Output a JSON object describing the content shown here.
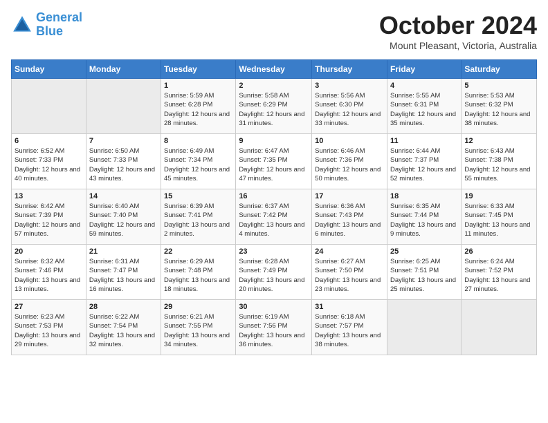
{
  "logo": {
    "line1": "General",
    "line2": "Blue"
  },
  "title": "October 2024",
  "subtitle": "Mount Pleasant, Victoria, Australia",
  "days_of_week": [
    "Sunday",
    "Monday",
    "Tuesday",
    "Wednesday",
    "Thursday",
    "Friday",
    "Saturday"
  ],
  "weeks": [
    [
      {
        "day": "",
        "info": ""
      },
      {
        "day": "",
        "info": ""
      },
      {
        "day": "1",
        "info": "Sunrise: 5:59 AM\nSunset: 6:28 PM\nDaylight: 12 hours and 28 minutes."
      },
      {
        "day": "2",
        "info": "Sunrise: 5:58 AM\nSunset: 6:29 PM\nDaylight: 12 hours and 31 minutes."
      },
      {
        "day": "3",
        "info": "Sunrise: 5:56 AM\nSunset: 6:30 PM\nDaylight: 12 hours and 33 minutes."
      },
      {
        "day": "4",
        "info": "Sunrise: 5:55 AM\nSunset: 6:31 PM\nDaylight: 12 hours and 35 minutes."
      },
      {
        "day": "5",
        "info": "Sunrise: 5:53 AM\nSunset: 6:32 PM\nDaylight: 12 hours and 38 minutes."
      }
    ],
    [
      {
        "day": "6",
        "info": "Sunrise: 6:52 AM\nSunset: 7:33 PM\nDaylight: 12 hours and 40 minutes."
      },
      {
        "day": "7",
        "info": "Sunrise: 6:50 AM\nSunset: 7:33 PM\nDaylight: 12 hours and 43 minutes."
      },
      {
        "day": "8",
        "info": "Sunrise: 6:49 AM\nSunset: 7:34 PM\nDaylight: 12 hours and 45 minutes."
      },
      {
        "day": "9",
        "info": "Sunrise: 6:47 AM\nSunset: 7:35 PM\nDaylight: 12 hours and 47 minutes."
      },
      {
        "day": "10",
        "info": "Sunrise: 6:46 AM\nSunset: 7:36 PM\nDaylight: 12 hours and 50 minutes."
      },
      {
        "day": "11",
        "info": "Sunrise: 6:44 AM\nSunset: 7:37 PM\nDaylight: 12 hours and 52 minutes."
      },
      {
        "day": "12",
        "info": "Sunrise: 6:43 AM\nSunset: 7:38 PM\nDaylight: 12 hours and 55 minutes."
      }
    ],
    [
      {
        "day": "13",
        "info": "Sunrise: 6:42 AM\nSunset: 7:39 PM\nDaylight: 12 hours and 57 minutes."
      },
      {
        "day": "14",
        "info": "Sunrise: 6:40 AM\nSunset: 7:40 PM\nDaylight: 12 hours and 59 minutes."
      },
      {
        "day": "15",
        "info": "Sunrise: 6:39 AM\nSunset: 7:41 PM\nDaylight: 13 hours and 2 minutes."
      },
      {
        "day": "16",
        "info": "Sunrise: 6:37 AM\nSunset: 7:42 PM\nDaylight: 13 hours and 4 minutes."
      },
      {
        "day": "17",
        "info": "Sunrise: 6:36 AM\nSunset: 7:43 PM\nDaylight: 13 hours and 6 minutes."
      },
      {
        "day": "18",
        "info": "Sunrise: 6:35 AM\nSunset: 7:44 PM\nDaylight: 13 hours and 9 minutes."
      },
      {
        "day": "19",
        "info": "Sunrise: 6:33 AM\nSunset: 7:45 PM\nDaylight: 13 hours and 11 minutes."
      }
    ],
    [
      {
        "day": "20",
        "info": "Sunrise: 6:32 AM\nSunset: 7:46 PM\nDaylight: 13 hours and 13 minutes."
      },
      {
        "day": "21",
        "info": "Sunrise: 6:31 AM\nSunset: 7:47 PM\nDaylight: 13 hours and 16 minutes."
      },
      {
        "day": "22",
        "info": "Sunrise: 6:29 AM\nSunset: 7:48 PM\nDaylight: 13 hours and 18 minutes."
      },
      {
        "day": "23",
        "info": "Sunrise: 6:28 AM\nSunset: 7:49 PM\nDaylight: 13 hours and 20 minutes."
      },
      {
        "day": "24",
        "info": "Sunrise: 6:27 AM\nSunset: 7:50 PM\nDaylight: 13 hours and 23 minutes."
      },
      {
        "day": "25",
        "info": "Sunrise: 6:25 AM\nSunset: 7:51 PM\nDaylight: 13 hours and 25 minutes."
      },
      {
        "day": "26",
        "info": "Sunrise: 6:24 AM\nSunset: 7:52 PM\nDaylight: 13 hours and 27 minutes."
      }
    ],
    [
      {
        "day": "27",
        "info": "Sunrise: 6:23 AM\nSunset: 7:53 PM\nDaylight: 13 hours and 29 minutes."
      },
      {
        "day": "28",
        "info": "Sunrise: 6:22 AM\nSunset: 7:54 PM\nDaylight: 13 hours and 32 minutes."
      },
      {
        "day": "29",
        "info": "Sunrise: 6:21 AM\nSunset: 7:55 PM\nDaylight: 13 hours and 34 minutes."
      },
      {
        "day": "30",
        "info": "Sunrise: 6:19 AM\nSunset: 7:56 PM\nDaylight: 13 hours and 36 minutes."
      },
      {
        "day": "31",
        "info": "Sunrise: 6:18 AM\nSunset: 7:57 PM\nDaylight: 13 hours and 38 minutes."
      },
      {
        "day": "",
        "info": ""
      },
      {
        "day": "",
        "info": ""
      }
    ]
  ]
}
